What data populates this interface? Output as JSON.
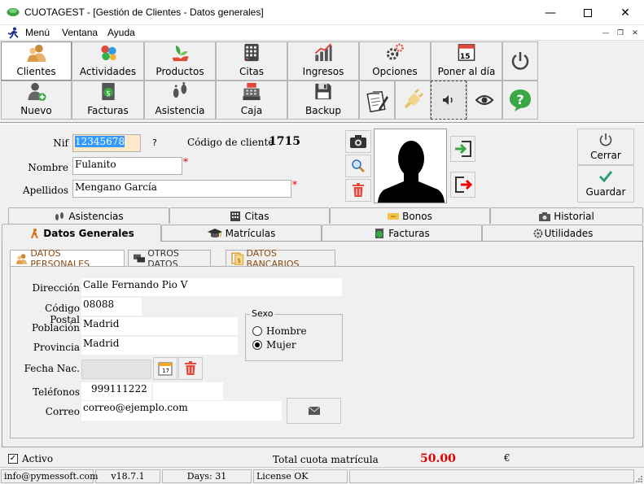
{
  "window": {
    "title": "CUOTAGEST - [Gestión de Clientes - Datos generales]"
  },
  "menu": {
    "items": [
      "Menú",
      "Ventana",
      "Ayuda"
    ]
  },
  "toolbar": {
    "row1": [
      {
        "label": "Clientes",
        "icon": "people-icon"
      },
      {
        "label": "Actividades",
        "icon": "balls-icon"
      },
      {
        "label": "Productos",
        "icon": "plant-icon"
      },
      {
        "label": "Citas",
        "icon": "calendar-grid-icon"
      },
      {
        "label": "Ingresos",
        "icon": "bar-chart-icon"
      },
      {
        "label": "Opciones",
        "icon": "gears-icon"
      },
      {
        "label": "Poner al día",
        "icon": "calendar-15-icon",
        "day": "15"
      }
    ],
    "row2": [
      {
        "label": "Nuevo",
        "icon": "user-add-icon"
      },
      {
        "label": "Facturas",
        "icon": "invoice-icon"
      },
      {
        "label": "Asistencia",
        "icon": "footprints-icon"
      },
      {
        "label": "Caja",
        "icon": "cash-register-icon"
      },
      {
        "label": "Backup",
        "icon": "floppy-disk-icon"
      }
    ]
  },
  "client": {
    "nif_label": "Nif",
    "nif_value": "12345678",
    "nif_help": "?",
    "code_label": "Código de cliente",
    "code_value": "1715",
    "name_label": "Nombre",
    "name_value": "Fulanito",
    "surname_label": "Apellidos",
    "surname_value": "Mengano García",
    "required_mark": "*"
  },
  "actions": {
    "close_label": "Cerrar",
    "save_label": "Guardar"
  },
  "tabs_row1": [
    "Asistencias",
    "Citas",
    "Bonos",
    "Historial"
  ],
  "tabs_row2": [
    "Datos Generales",
    "Matrículas",
    "Facturas",
    "Utilidades"
  ],
  "subtabs": [
    "DATOS PERSONALES",
    "OTROS DATOS",
    "DATOS BANCARIOS"
  ],
  "form": {
    "direccion_label": "Dirección",
    "direccion_value": "Calle Fernando Pio V",
    "cp_label": "Código Postal",
    "cp_value": "08088",
    "poblacion_label": "Población",
    "poblacion_value": "Madrid",
    "provincia_label": "Provincia",
    "provincia_value": "Madrid",
    "fecha_label": "Fecha Nac.",
    "fecha_value": "",
    "telefonos_label": "Teléfonos",
    "telefono1_value": "999111222",
    "telefono2_value": "",
    "correo_label": "Correo",
    "correo_value": "correo@ejemplo.com",
    "sexo_label": "Sexo",
    "hombre_label": "Hombre",
    "mujer_label": "Mujer",
    "calendar_day": "17"
  },
  "footer": {
    "activo_label": "Activo",
    "total_label": "Total cuota matrícula",
    "total_value": "50.00",
    "currency": "€"
  },
  "status": {
    "email": "info@pymessoft.com",
    "version": "v18.7.1",
    "days": "Days: 31",
    "license": "License OK"
  },
  "colors": {
    "accent_red": "#e00000",
    "selection_blue": "#3399ff",
    "nif_bg": "#fde9c9"
  }
}
